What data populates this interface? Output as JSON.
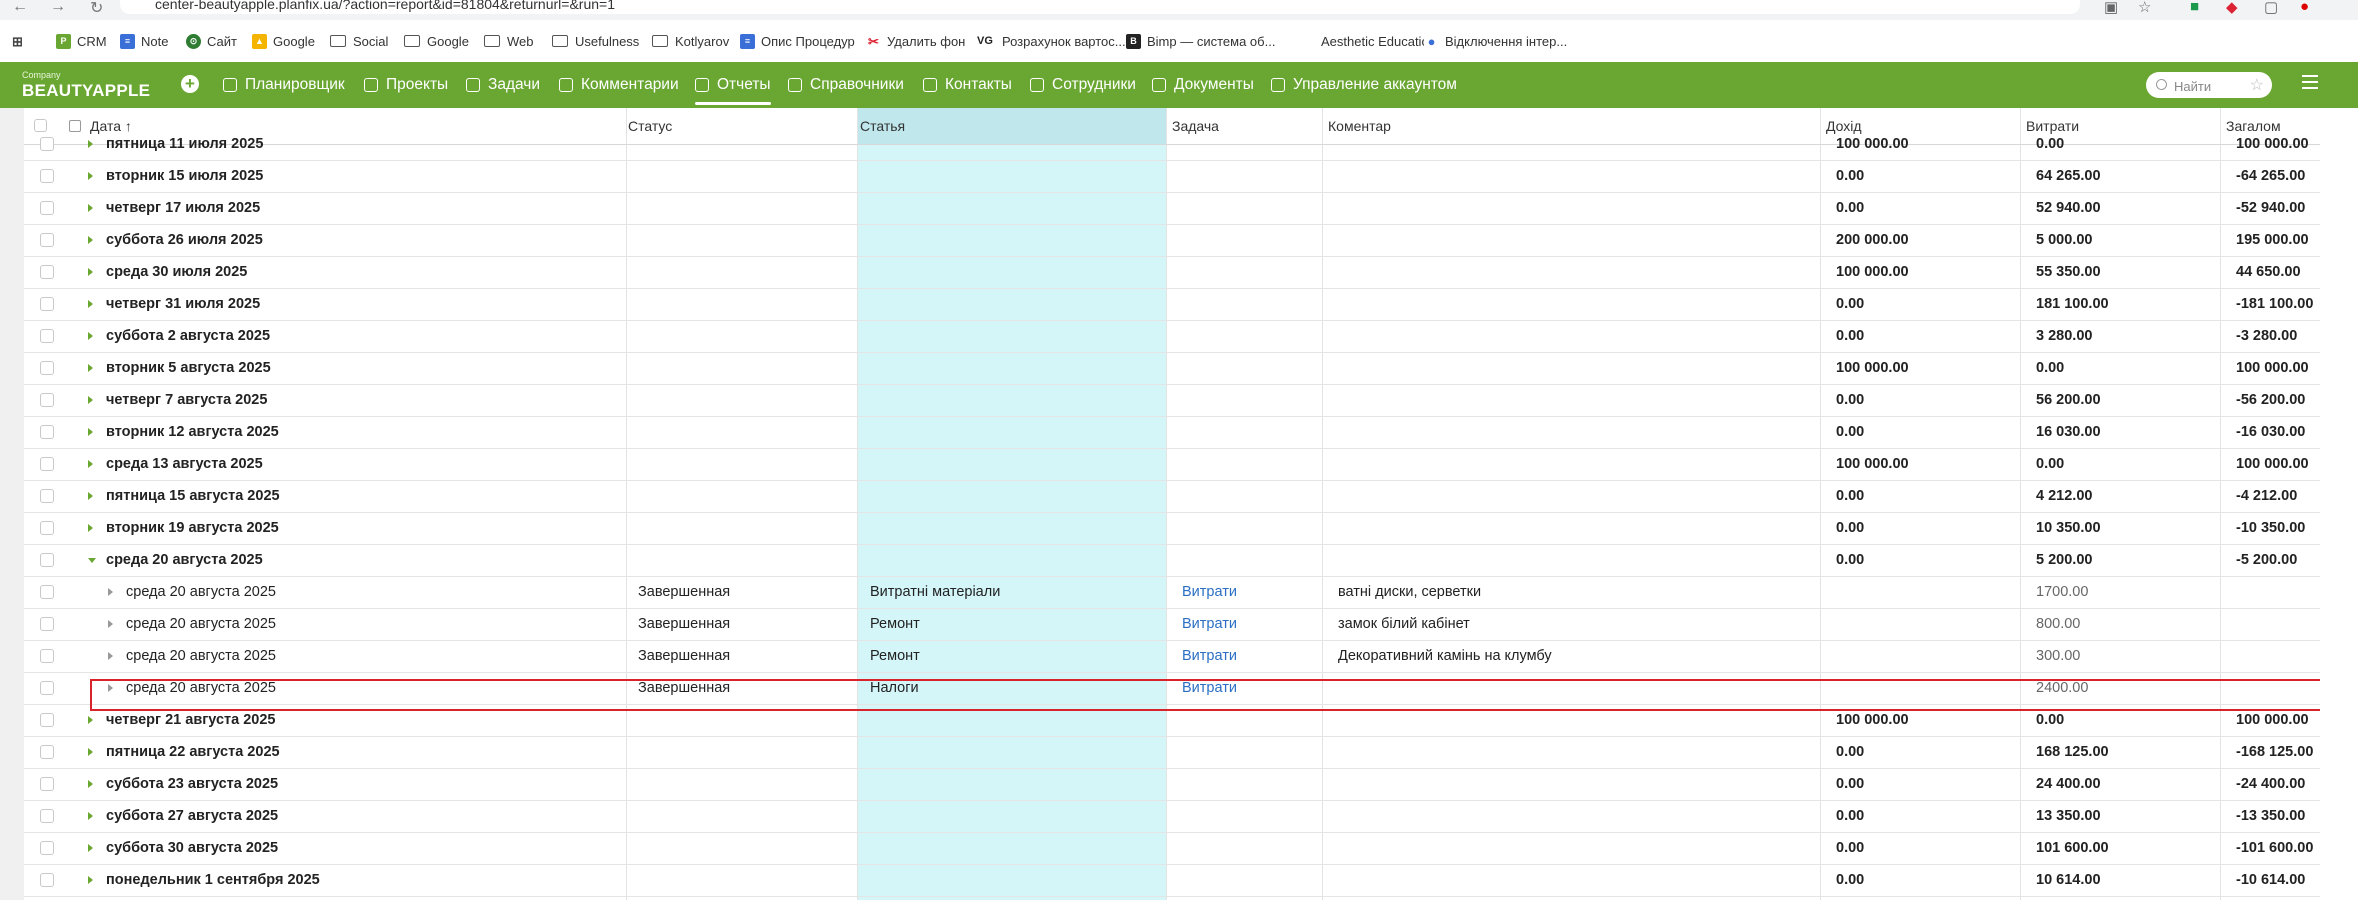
{
  "browser": {
    "url": "center-beautyapple.planfix.ua/?action=report&id=81804&returnurl=&run=1",
    "bookmarks": [
      "CRM",
      "Note",
      "Сайт",
      "Google",
      "Social",
      "Google",
      "Web",
      "Usefulness",
      "Kotlyarov",
      "Опис Процедур",
      "Удалить фон",
      "Розрахунок вартос...",
      "Bimp — система об...",
      "Aesthetic Education",
      "Відключення інтер..."
    ]
  },
  "header": {
    "company_small": "Company",
    "company_name": "BEAUTYAPPLE",
    "nav": [
      "Планировщик",
      "Проекты",
      "Задачи",
      "Комментарии",
      "Отчеты",
      "Справочники",
      "Контакты",
      "Сотрудники",
      "Документы",
      "Управление аккаунтом"
    ],
    "active_nav": "Отчеты",
    "search_placeholder": "Найти",
    "accent_color": "#6aa732"
  },
  "table": {
    "columns": [
      "Дата",
      "Статус",
      "Статья",
      "Задача",
      "Коментар",
      "Дохід",
      "Витрати",
      "Загалом"
    ],
    "sort_indicator": "↑",
    "rows": [
      {
        "date": "пятница 11 июля 2025",
        "income": "100 000.00",
        "expense": "0.00",
        "total": "100 000.00"
      },
      {
        "date": "вторник 15 июля 2025",
        "income": "0.00",
        "expense": "64 265.00",
        "total": "-64 265.00"
      },
      {
        "date": "четверг 17 июля 2025",
        "income": "0.00",
        "expense": "52 940.00",
        "total": "-52 940.00"
      },
      {
        "date": "суббота 26 июля 2025",
        "income": "200 000.00",
        "expense": "5 000.00",
        "total": "195 000.00"
      },
      {
        "date": "среда 30 июля 2025",
        "income": "100 000.00",
        "expense": "55 350.00",
        "total": "44 650.00"
      },
      {
        "date": "четверг 31 июля 2025",
        "income": "0.00",
        "expense": "181 100.00",
        "total": "-181 100.00"
      },
      {
        "date": "суббота 2 августа 2025",
        "income": "0.00",
        "expense": "3 280.00",
        "total": "-3 280.00"
      },
      {
        "date": "вторник 5 августа 2025",
        "income": "100 000.00",
        "expense": "0.00",
        "total": "100 000.00"
      },
      {
        "date": "четверг 7 августа 2025",
        "income": "0.00",
        "expense": "56 200.00",
        "total": "-56 200.00"
      },
      {
        "date": "вторник 12 августа 2025",
        "income": "0.00",
        "expense": "16 030.00",
        "total": "-16 030.00"
      },
      {
        "date": "среда 13 августа 2025",
        "income": "100 000.00",
        "expense": "0.00",
        "total": "100 000.00"
      },
      {
        "date": "пятница 15 августа 2025",
        "income": "0.00",
        "expense": "4 212.00",
        "total": "-4 212.00"
      },
      {
        "date": "вторник 19 августа 2025",
        "income": "0.00",
        "expense": "10 350.00",
        "total": "-10 350.00"
      },
      {
        "date": "среда 20 августа 2025",
        "income": "0.00",
        "expense": "5 200.00",
        "total": "-5 200.00",
        "expanded": true
      },
      {
        "date": "среда 20 августа 2025",
        "status": "Завершенная",
        "article": "Витратні матеріали",
        "task": "Витрати",
        "comment": "ватні диски, серветки",
        "expense": "1700.00",
        "child": true
      },
      {
        "date": "среда 20 августа 2025",
        "status": "Завершенная",
        "article": "Ремонт",
        "task": "Витрати",
        "comment": "замок білий кабінет",
        "expense": "800.00",
        "child": true
      },
      {
        "date": "среда 20 августа 2025",
        "status": "Завершенная",
        "article": "Ремонт",
        "task": "Витрати",
        "comment": "Декоративний камінь на клумбу",
        "expense": "300.00",
        "child": true
      },
      {
        "date": "среда 20 августа 2025",
        "status": "Завершенная",
        "article": "Налоги",
        "task": "Витрати",
        "comment": "",
        "expense": "2400.00",
        "child": true,
        "highlighted": true
      },
      {
        "date": "четверг 21 августа 2025",
        "income": "100 000.00",
        "expense": "0.00",
        "total": "100 000.00"
      },
      {
        "date": "пятница 22 августа 2025",
        "income": "0.00",
        "expense": "168 125.00",
        "total": "-168 125.00"
      },
      {
        "date": "суббота 23 августа 2025",
        "income": "0.00",
        "expense": "24 400.00",
        "total": "-24 400.00"
      },
      {
        "date": "суббота 27 августа 2025",
        "income": "0.00",
        "expense": "13 350.00",
        "total": "-13 350.00"
      },
      {
        "date": "суббота 30 августа 2025",
        "income": "0.00",
        "expense": "101 600.00",
        "total": "-101 600.00"
      },
      {
        "date": "понедельник 1 сентября 2025",
        "income": "0.00",
        "expense": "10 614.00",
        "total": "-10 614.00"
      }
    ]
  }
}
